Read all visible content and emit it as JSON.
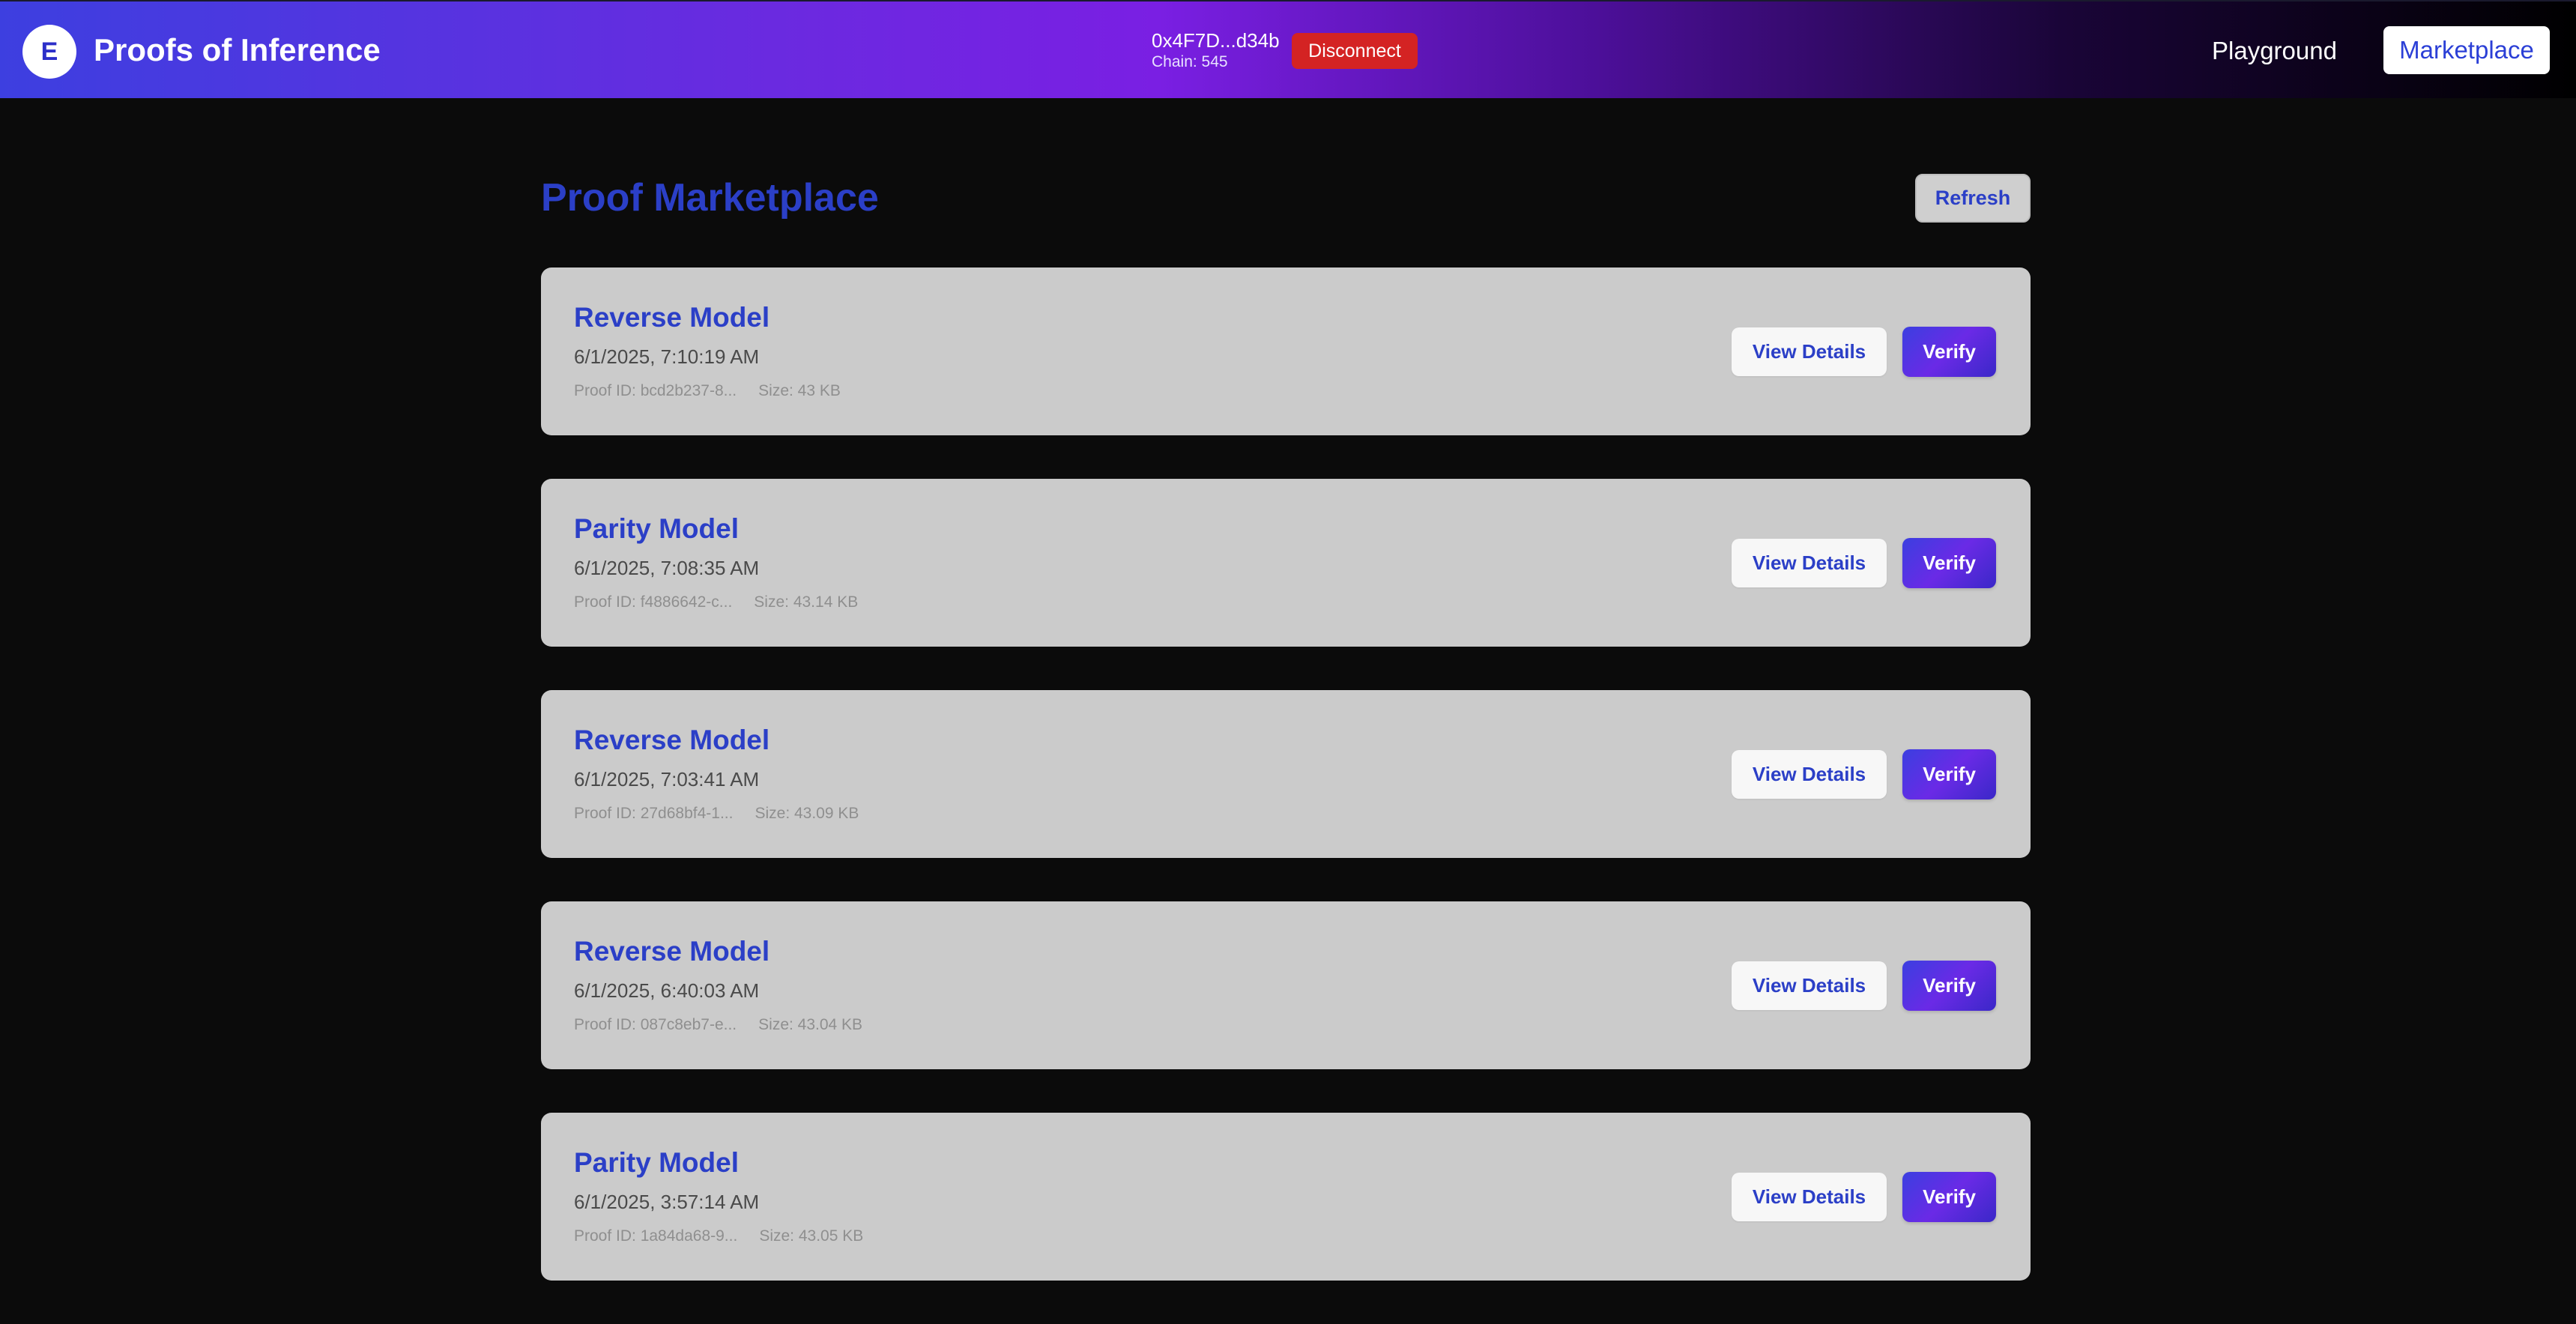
{
  "header": {
    "logo_letter": "E",
    "title": "Proofs of Inference",
    "wallet_address": "0x4F7D...d34b",
    "chain": "Chain: 545",
    "disconnect_label": "Disconnect",
    "nav": {
      "playground": "Playground",
      "marketplace": "Marketplace"
    }
  },
  "main": {
    "title": "Proof Marketplace",
    "refresh_label": "Refresh",
    "proofs": [
      {
        "model": "Reverse Model",
        "date": "6/1/2025, 7:10:19 AM",
        "proof_id": "Proof ID: bcd2b237-8...",
        "size": "Size: 43 KB",
        "view_label": "View Details",
        "verify_label": "Verify"
      },
      {
        "model": "Parity Model",
        "date": "6/1/2025, 7:08:35 AM",
        "proof_id": "Proof ID: f4886642-c...",
        "size": "Size: 43.14 KB",
        "view_label": "View Details",
        "verify_label": "Verify"
      },
      {
        "model": "Reverse Model",
        "date": "6/1/2025, 7:03:41 AM",
        "proof_id": "Proof ID: 27d68bf4-1...",
        "size": "Size: 43.09 KB",
        "view_label": "View Details",
        "verify_label": "Verify"
      },
      {
        "model": "Reverse Model",
        "date": "6/1/2025, 6:40:03 AM",
        "proof_id": "Proof ID: 087c8eb7-e...",
        "size": "Size: 43.04 KB",
        "view_label": "View Details",
        "verify_label": "Verify"
      },
      {
        "model": "Parity Model",
        "date": "6/1/2025, 3:57:14 AM",
        "proof_id": "Proof ID: 1a84da68-9...",
        "size": "Size: 43.05 KB",
        "view_label": "View Details",
        "verify_label": "Verify"
      }
    ]
  },
  "colors": {
    "accent": "#2b3fc7",
    "disconnect": "#d42323",
    "background": "#0b0b0b",
    "card": "#cbcbcb"
  }
}
